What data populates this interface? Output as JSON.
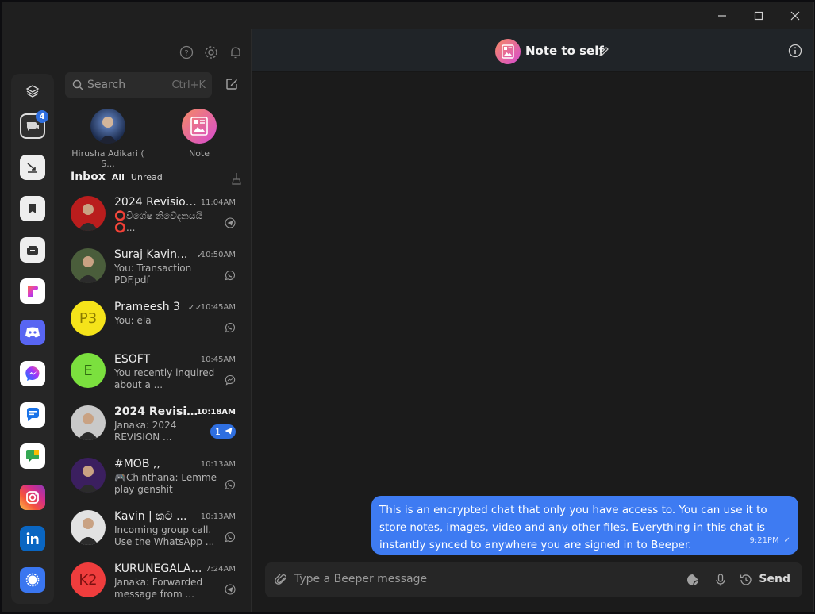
{
  "window": {
    "controls": {
      "minimize": "—",
      "maximize": "☐",
      "close": "✕"
    }
  },
  "sidebar": {
    "search": {
      "placeholder": "Search",
      "shortcut": "Ctrl+K"
    },
    "rail": [
      {
        "icon": "layers-icon"
      },
      {
        "icon": "all-chats-icon",
        "badge": "4"
      },
      {
        "icon": "low-priority-icon"
      },
      {
        "icon": "bookmark-icon"
      },
      {
        "icon": "archive-icon"
      },
      {
        "icon": "beeper-app-icon"
      },
      {
        "icon": "discord-icon"
      },
      {
        "icon": "messenger-icon"
      },
      {
        "icon": "google-messages-icon"
      },
      {
        "icon": "google-chat-icon"
      },
      {
        "icon": "instagram-icon"
      },
      {
        "icon": "linkedin-icon"
      },
      {
        "icon": "signal-icon"
      }
    ],
    "pinned": [
      {
        "name": "Hirusha Adikari ( S..."
      },
      {
        "name": "Note"
      }
    ],
    "filters": {
      "inbox": "Inbox",
      "all": "All",
      "unread": "Unread"
    },
    "chats": [
      {
        "name": "2024 Revision ...",
        "time": "11:04AM",
        "preview": "⭕විශේෂ නිවේදනයයි ⭕...",
        "network": "telegram",
        "avatar_initials": "",
        "avatar_color": "#b91d1d"
      },
      {
        "name": "Suraj Kavin...",
        "time": "10:50AM",
        "tick": "✓",
        "preview": "You: Transaction PDF.pdf",
        "network": "whatsapp",
        "avatar_initials": "",
        "avatar_color": "#4a5d3b"
      },
      {
        "name": "Prameesh 3",
        "time": "10:45AM",
        "tick": "✓✓",
        "preview": "You: ela",
        "network": "whatsapp",
        "avatar_initials": "P3",
        "avatar_color": "#f5e31a"
      },
      {
        "name": "ESOFT",
        "time": "10:45AM",
        "preview": "You recently inquired about a ...",
        "network": "messenger",
        "avatar_initials": "E",
        "avatar_color": "#7be03e"
      },
      {
        "name": "2024 Revisio...",
        "time": "10:18AM",
        "preview": "Janaka: 2024 REVISION ...",
        "network": "telegram",
        "unread": "1",
        "bold": true,
        "avatar_initials": "",
        "avatar_color": "#c9c9c9"
      },
      {
        "name": "#MOB ,,",
        "time": "10:13AM",
        "preview": "🎮Chinthana: Lemme play genshit",
        "network": "whatsapp",
        "avatar_initials": "",
        "avatar_color": "#3b1f5f"
      },
      {
        "name": "Kavin | කට ...",
        "time": "10:13AM",
        "preview": "Incoming group call. Use the WhatsApp ...",
        "network": "whatsapp",
        "avatar_initials": "",
        "avatar_color": "#e2e2e2"
      },
      {
        "name": "KURUNEGALA ...",
        "time": "7:24AM",
        "preview": "Janaka: Forwarded message from ...",
        "network": "telegram",
        "avatar_initials": "K2",
        "avatar_color": "#ef3d3d"
      }
    ]
  },
  "chat": {
    "title": "Note to self",
    "message": {
      "text": "This is an encrypted chat that only you have access to. You can use it to store notes, images, video and any other files. Everything in this chat is instantly synced to anywhere you are signed in to Beeper.",
      "time": "9:21PM",
      "status": "✓"
    },
    "composer": {
      "placeholder": "Type a Beeper message",
      "send": "Send"
    }
  },
  "colors": {
    "accent": "#3e7bf2",
    "badge": "#2f6fe0"
  }
}
